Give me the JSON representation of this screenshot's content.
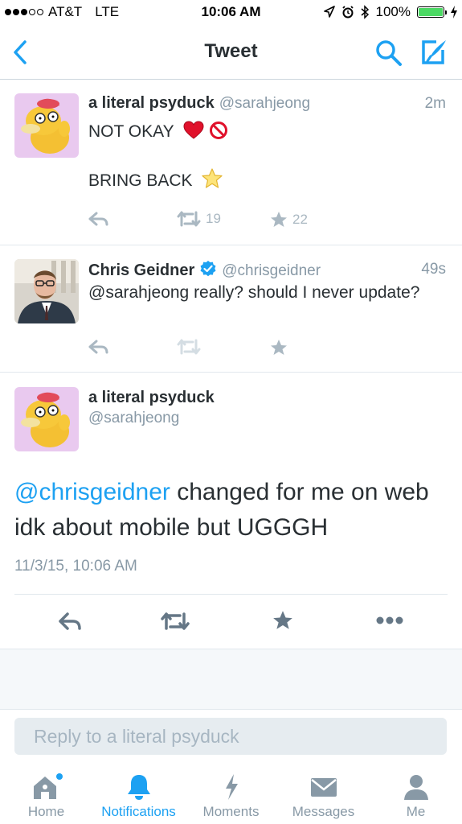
{
  "status_bar": {
    "carrier": "AT&T",
    "network": "LTE",
    "time": "10:06 AM",
    "battery_percent": "100%"
  },
  "nav": {
    "title": "Tweet",
    "back_icon": "chevron-left-icon",
    "search_icon": "search-icon",
    "compose_icon": "compose-icon"
  },
  "tweets": [
    {
      "name": "a literal psyduck",
      "handle": "@sarahjeong",
      "time": "2m",
      "line1": "NOT OKAY",
      "line2": "BRING BACK",
      "retweets": "19",
      "likes": "22"
    },
    {
      "name": "Chris Geidner",
      "handle": "@chrisgeidner",
      "time": "49s",
      "verified": true,
      "text": "@sarahjeong really? should I never update?"
    }
  ],
  "detail": {
    "name": "a literal psyduck",
    "handle": "@sarahjeong",
    "mention": "@chrisgeidner",
    "text": " changed for me on web idk about mobile but UGGGH",
    "date": "11/3/15, 10:06 AM"
  },
  "reply": {
    "placeholder": "Reply to a literal psyduck"
  },
  "tabs": [
    {
      "label": "Home",
      "icon": "home-icon"
    },
    {
      "label": "Notifications",
      "icon": "bell-icon",
      "active": true
    },
    {
      "label": "Moments",
      "icon": "lightning-icon"
    },
    {
      "label": "Messages",
      "icon": "envelope-icon"
    },
    {
      "label": "Me",
      "icon": "person-icon"
    }
  ],
  "colors": {
    "accent": "#1da1f2",
    "muted": "#8899a6",
    "action": "#aab8c2"
  }
}
